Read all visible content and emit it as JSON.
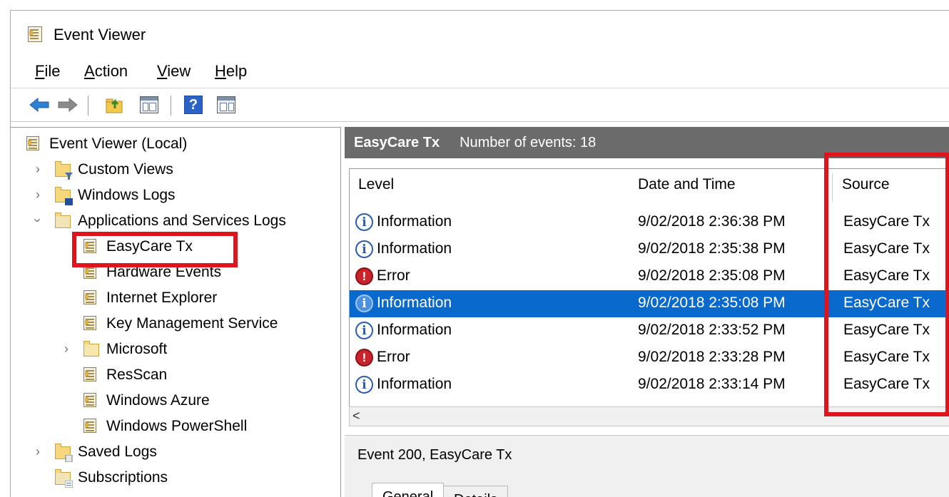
{
  "title": "Event Viewer",
  "menu": {
    "file": {
      "acc": "F",
      "rest": "ile"
    },
    "action": {
      "acc": "A",
      "rest": "ction"
    },
    "view": {
      "acc": "V",
      "rest": "iew"
    },
    "help": {
      "acc": "H",
      "rest": "elp"
    }
  },
  "toolbar": {
    "icons": [
      "back-arrow-icon",
      "forward-arrow-icon",
      "up-folder-icon",
      "show-hide-console-tree-icon",
      "help-icon",
      "show-hide-action-pane-icon"
    ]
  },
  "tree": {
    "root": "Event Viewer (Local)",
    "custom_views": "Custom Views",
    "windows_logs": "Windows Logs",
    "apps_services": "Applications and Services Logs",
    "children": [
      "EasyCare Tx",
      "Hardware Events",
      "Internet Explorer",
      "Key Management Service",
      "Microsoft",
      "ResScan",
      "Windows Azure",
      "Windows PowerShell"
    ],
    "saved_logs": "Saved Logs",
    "subscriptions": "Subscriptions"
  },
  "events_panel": {
    "log_name": "EasyCare Tx",
    "count_text": "Number of events: 18",
    "columns": {
      "level": "Level",
      "date": "Date and Time",
      "source": "Source"
    },
    "rows": [
      {
        "level": "Information",
        "date": "9/02/2018 2:36:38 PM",
        "source": "EasyCare Tx"
      },
      {
        "level": "Information",
        "date": "9/02/2018 2:35:38 PM",
        "source": "EasyCare Tx"
      },
      {
        "level": "Error",
        "date": "9/02/2018 2:35:08 PM",
        "source": "EasyCare Tx"
      },
      {
        "level": "Information",
        "date": "9/02/2018 2:35:08 PM",
        "source": "EasyCare Tx"
      },
      {
        "level": "Information",
        "date": "9/02/2018 2:33:52 PM",
        "source": "EasyCare Tx"
      },
      {
        "level": "Error",
        "date": "9/02/2018 2:33:28 PM",
        "source": "EasyCare Tx"
      },
      {
        "level": "Information",
        "date": "9/02/2018 2:33:14 PM",
        "source": "EasyCare Tx"
      }
    ],
    "selected_row": 3,
    "scroll_left_glyph": "<"
  },
  "detail": {
    "title": "Event 200, EasyCare Tx",
    "tabs": [
      "General",
      "Details"
    ]
  },
  "colors": {
    "header_bg": "#6b6b6b",
    "selection": "#0a69cc",
    "annotation": "#e0141c"
  }
}
